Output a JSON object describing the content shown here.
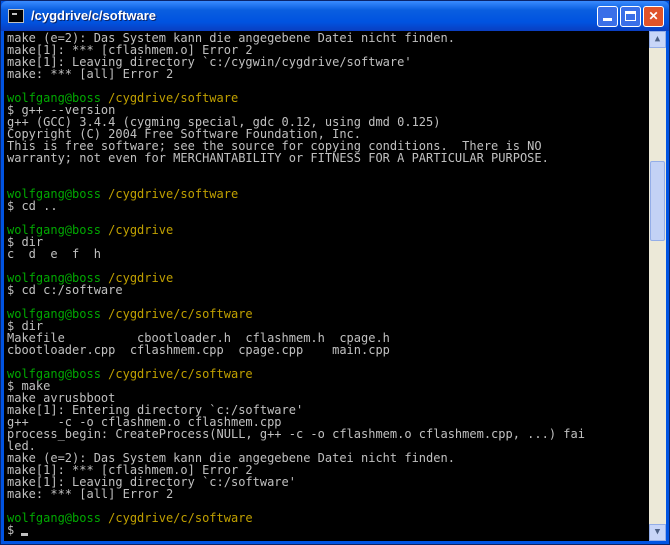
{
  "window": {
    "title": "/cygdrive/c/software"
  },
  "icons": {
    "app": "console-icon",
    "minimize": "minimize-icon",
    "maximize": "maximize-icon",
    "close": "close-icon",
    "scroll_up": "scroll-up-arrow-icon",
    "scroll_down": "scroll-down-arrow-icon"
  },
  "colors": {
    "background": "#000000",
    "text": "#c0c0c0",
    "prompt_user": "#00a800",
    "prompt_path": "#c0a000",
    "titlebar": "#0054e3"
  },
  "console": {
    "lines": [
      {
        "type": "text",
        "text": "make (e=2): Das System kann die angegebene Datei nicht finden."
      },
      {
        "type": "text",
        "text": "make[1]: *** [cflashmem.o] Error 2"
      },
      {
        "type": "text",
        "text": "make[1]: Leaving directory `c:/cygwin/cygdrive/software'"
      },
      {
        "type": "text",
        "text": "make: *** [all] Error 2"
      },
      {
        "type": "text",
        "text": ""
      },
      {
        "type": "prompt",
        "user": "wolfgang@boss",
        "path": "/cygdrive/software"
      },
      {
        "type": "text",
        "text": "$ g++ --version"
      },
      {
        "type": "text",
        "text": "g++ (GCC) 3.4.4 (cygming special, gdc 0.12, using dmd 0.125)"
      },
      {
        "type": "text",
        "text": "Copyright (C) 2004 Free Software Foundation, Inc."
      },
      {
        "type": "text",
        "text": "This is free software; see the source for copying conditions.  There is NO"
      },
      {
        "type": "text",
        "text": "warranty; not even for MERCHANTABILITY or FITNESS FOR A PARTICULAR PURPOSE."
      },
      {
        "type": "text",
        "text": ""
      },
      {
        "type": "text",
        "text": ""
      },
      {
        "type": "prompt",
        "user": "wolfgang@boss",
        "path": "/cygdrive/software"
      },
      {
        "type": "text",
        "text": "$ cd .."
      },
      {
        "type": "text",
        "text": ""
      },
      {
        "type": "prompt",
        "user": "wolfgang@boss",
        "path": "/cygdrive"
      },
      {
        "type": "text",
        "text": "$ dir"
      },
      {
        "type": "text",
        "text": "c  d  e  f  h"
      },
      {
        "type": "text",
        "text": ""
      },
      {
        "type": "prompt",
        "user": "wolfgang@boss",
        "path": "/cygdrive"
      },
      {
        "type": "text",
        "text": "$ cd c:/software"
      },
      {
        "type": "text",
        "text": ""
      },
      {
        "type": "prompt",
        "user": "wolfgang@boss",
        "path": "/cygdrive/c/software"
      },
      {
        "type": "text",
        "text": "$ dir"
      },
      {
        "type": "text",
        "text": "Makefile          cbootloader.h  cflashmem.h  cpage.h"
      },
      {
        "type": "text",
        "text": "cbootloader.cpp  cflashmem.cpp  cpage.cpp    main.cpp"
      },
      {
        "type": "text",
        "text": ""
      },
      {
        "type": "prompt",
        "user": "wolfgang@boss",
        "path": "/cygdrive/c/software"
      },
      {
        "type": "text",
        "text": "$ make"
      },
      {
        "type": "text",
        "text": "make avrusbboot"
      },
      {
        "type": "text",
        "text": "make[1]: Entering directory `c:/software'"
      },
      {
        "type": "text",
        "text": "g++    -c -o cflashmem.o cflashmem.cpp"
      },
      {
        "type": "text",
        "text": "process_begin: CreateProcess(NULL, g++ -c -o cflashmem.o cflashmem.cpp, ...) fai"
      },
      {
        "type": "text",
        "text": "led."
      },
      {
        "type": "text",
        "text": "make (e=2): Das System kann die angegebene Datei nicht finden."
      },
      {
        "type": "text",
        "text": "make[1]: *** [cflashmem.o] Error 2"
      },
      {
        "type": "text",
        "text": "make[1]: Leaving directory `c:/software'"
      },
      {
        "type": "text",
        "text": "make: *** [all] Error 2"
      },
      {
        "type": "text",
        "text": ""
      },
      {
        "type": "prompt",
        "user": "wolfgang@boss",
        "path": "/cygdrive/c/software"
      },
      {
        "type": "input",
        "text": "$ "
      }
    ]
  }
}
